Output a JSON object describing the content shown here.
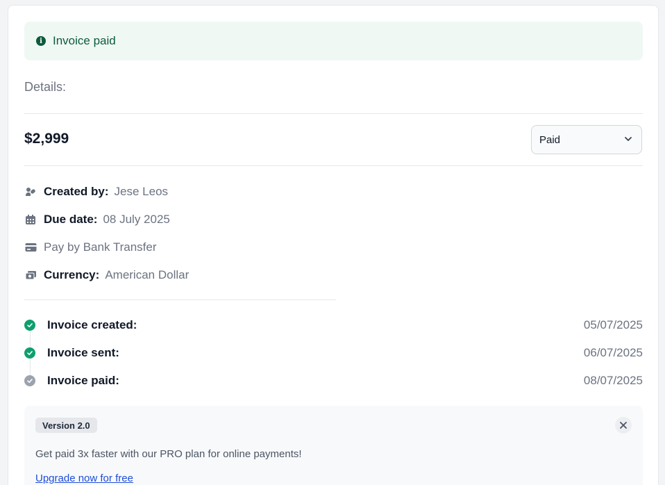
{
  "alert": {
    "text": "Invoice paid",
    "icon": "info-icon"
  },
  "details_label": "Details:",
  "amount": "$2,999",
  "status_select": {
    "value": "Paid",
    "icon": "chevron-down-icon"
  },
  "info": [
    {
      "icon": "users-icon",
      "key": "Created by:",
      "value": "Jese Leos"
    },
    {
      "icon": "calendar-icon",
      "key": "Due date:",
      "value": "08 July 2025"
    },
    {
      "icon": "credit-card-icon",
      "key": "",
      "value": "Pay by Bank Transfer"
    },
    {
      "icon": "cash-icon",
      "key": "Currency:",
      "value": "American Dollar"
    }
  ],
  "timeline": [
    {
      "label": "Invoice created:",
      "date": "05/07/2025",
      "status": "done",
      "color": "#0e9f6e"
    },
    {
      "label": "Invoice sent:",
      "date": "06/07/2025",
      "status": "done",
      "color": "#0e9f6e"
    },
    {
      "label": "Invoice paid:",
      "date": "08/07/2025",
      "status": "pending",
      "color": "#9ca3af"
    }
  ],
  "promo": {
    "badge": "Version 2.0",
    "text": "Get paid 3x faster with our PRO plan for online payments!",
    "link": "Upgrade now for free"
  },
  "colors": {
    "accent_green": "#0b5b3c",
    "alert_bg": "#f0f8f4",
    "link": "#1d4ed8"
  }
}
